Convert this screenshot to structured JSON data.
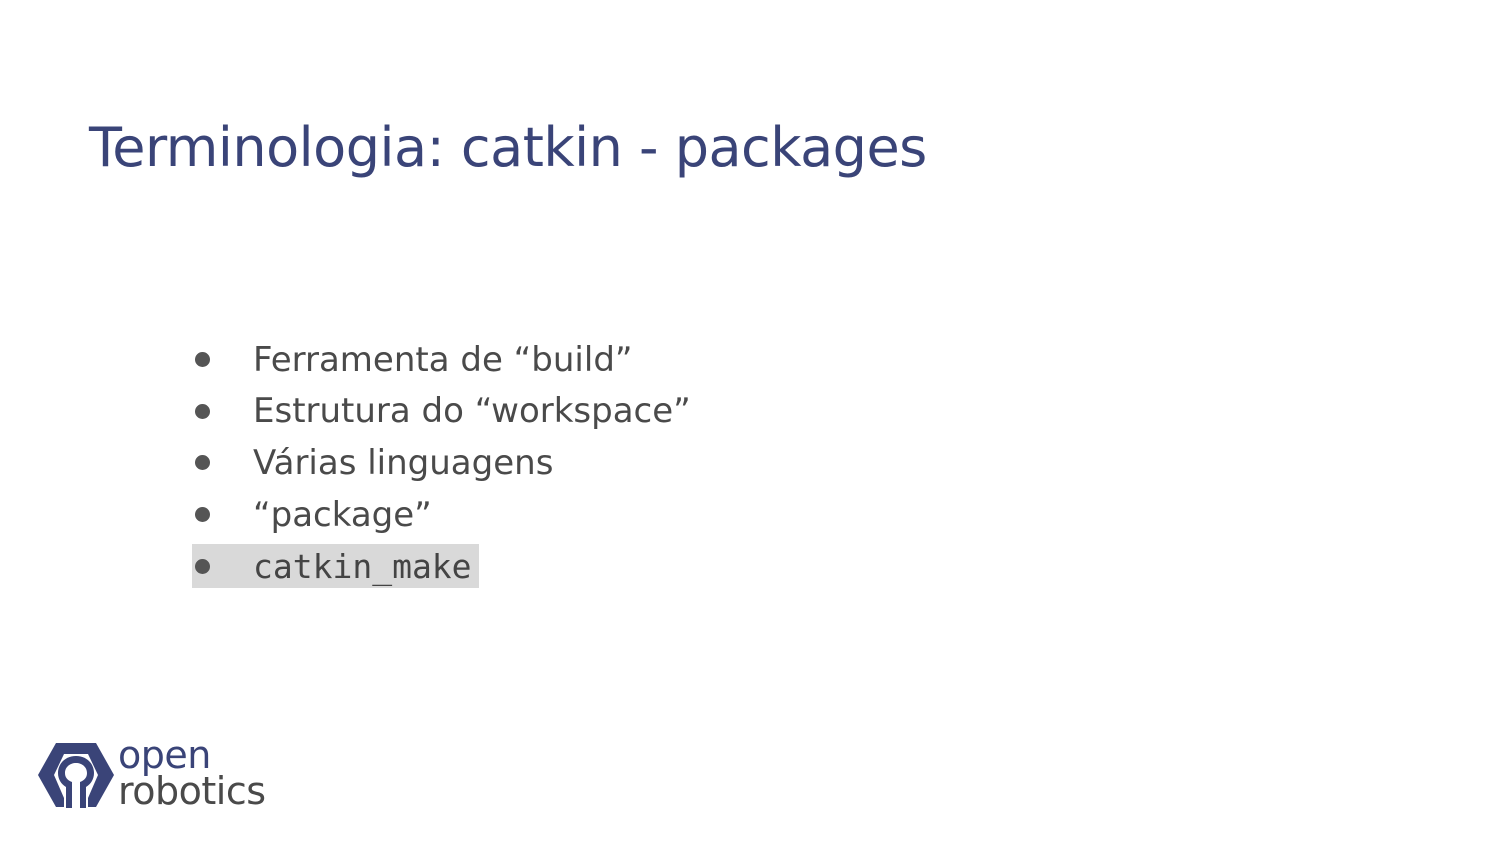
{
  "slide": {
    "title": "Terminologia: catkin - packages",
    "bullets": [
      {
        "text": "Ferramenta de “build”",
        "style": "normal"
      },
      {
        "text": "Estrutura do “workspace”",
        "style": "normal"
      },
      {
        "text": "Várias linguagens",
        "style": "normal"
      },
      {
        "text": "“package”",
        "style": "normal"
      },
      {
        "text": "catkin_make",
        "style": "code-highlighted"
      }
    ]
  },
  "logo": {
    "line1": "open",
    "line2": "robotics",
    "icon": "open-robotics-logo-mark"
  },
  "colors": {
    "title": "#3a4478",
    "body_text": "#4a4a4a",
    "bullet": "#555555",
    "highlight_bg": "#d9d9d9",
    "logo_primary": "#3a4478"
  }
}
